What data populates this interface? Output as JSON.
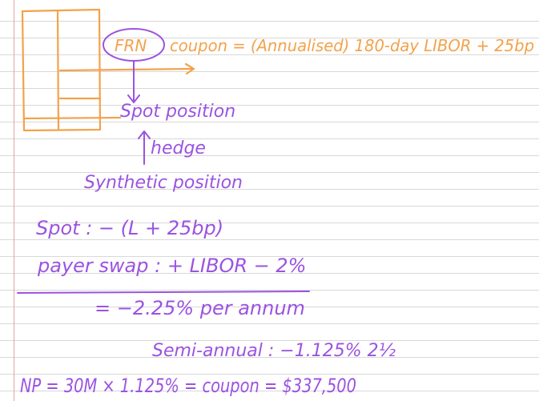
{
  "colors": {
    "orange_ink": "#f3a24b",
    "purple_ink": "#9b53e0",
    "rule_line": "#d8d8d8",
    "margin_line": "#e6a3a3"
  },
  "notes": {
    "frn_label": "FRN",
    "coupon_text": "coupon = (Annualised) 180-day LIBOR + 25bp",
    "spot_position": "Spot position",
    "hedge": "hedge",
    "synthetic_position": "Synthetic position",
    "spot_line": "Spot : − (L + 25bp)",
    "payer_swap_line": "payer swap : + LIBOR − 2%",
    "result_line": "= −2.25% per annum",
    "semi_annual_line": "Semi-annual : −1.125% 2½",
    "np_line": "NP = 30M × 1.125% = coupon = $337,500"
  }
}
